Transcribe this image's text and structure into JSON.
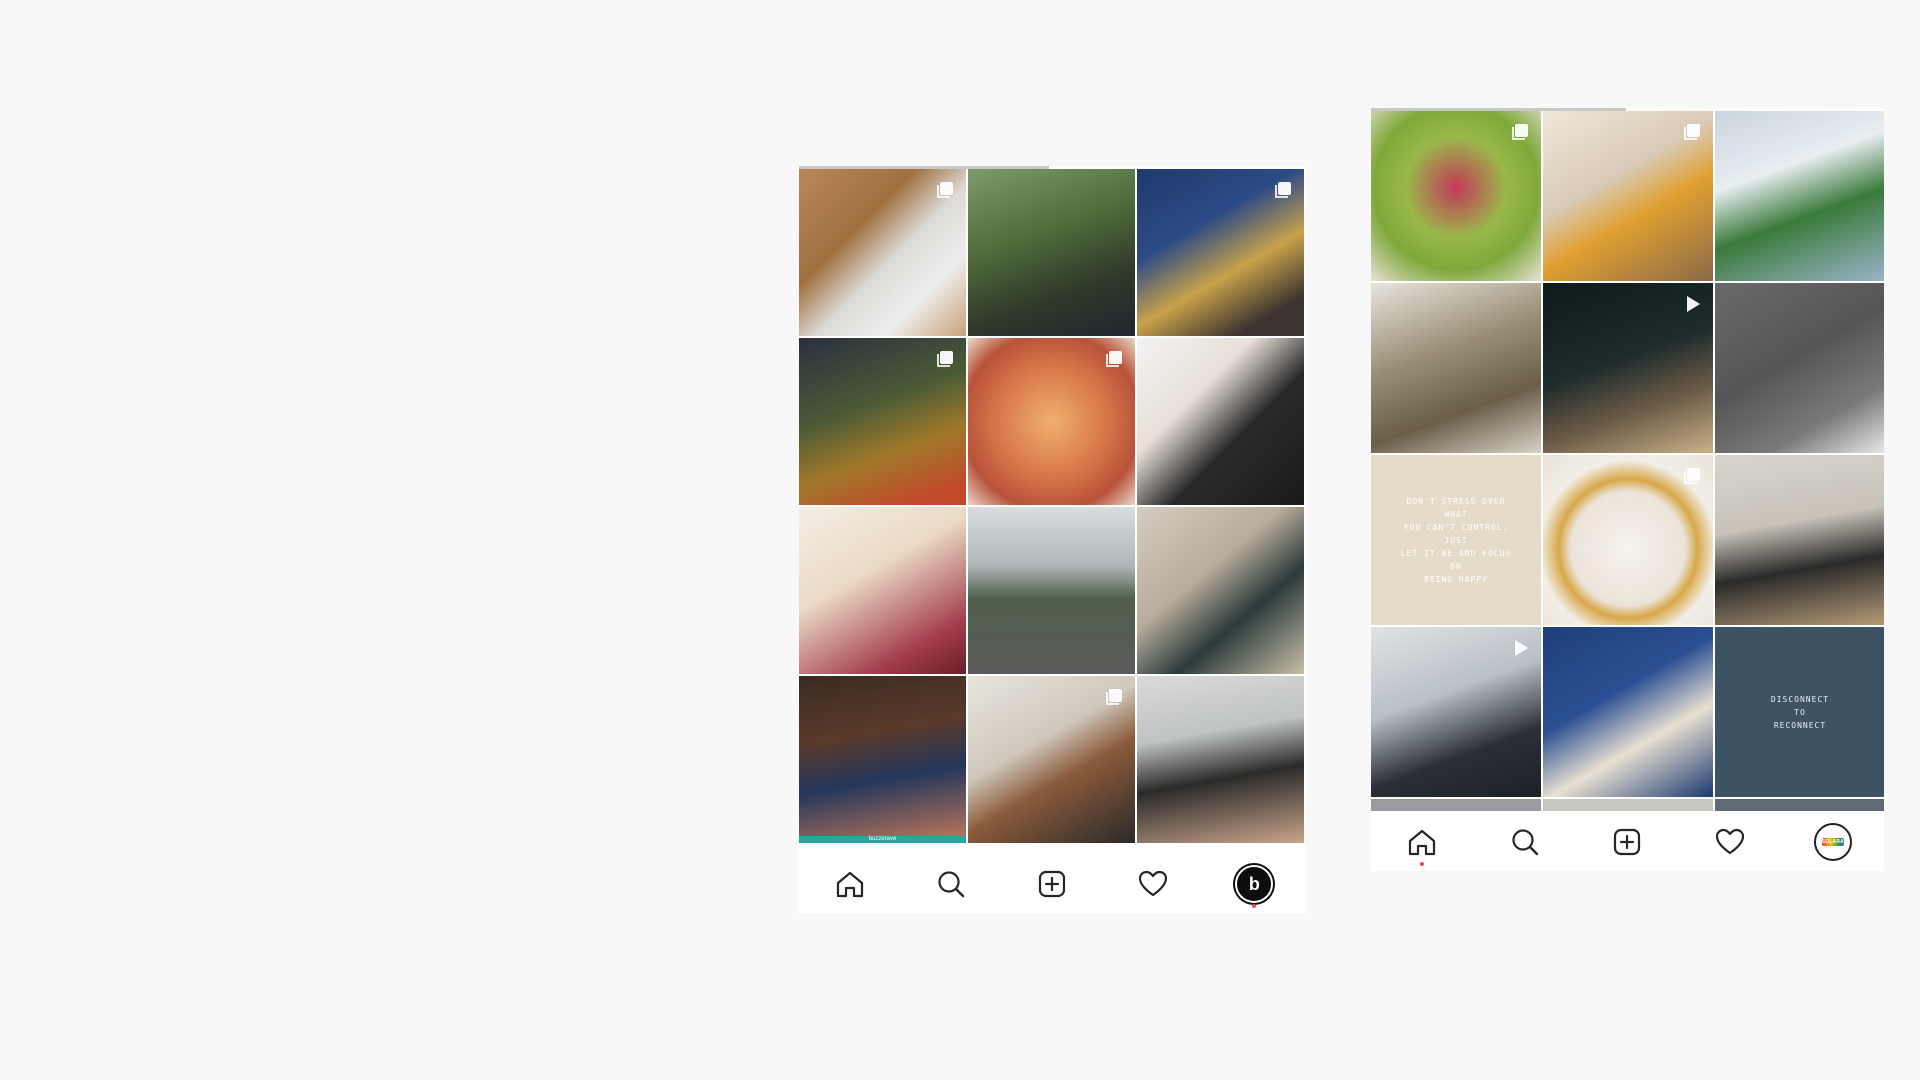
{
  "colors": {
    "page_background": "#f8f8f8",
    "panel_background": "#ffffff",
    "icon_color": "#262626",
    "active_dot": "#ed4956"
  },
  "left_profile": {
    "tiles": [
      {
        "name": "tile-foot-bath",
        "bg": "linear-gradient(135deg,#b9875a 0%,#a0703f 35%,#dcdad6 55%,#eeeeee 75%,#c9a27a 100%)",
        "badge": "multi-icon",
        "text": "",
        "caption": ""
      },
      {
        "name": "tile-garden-filming",
        "bg": "linear-gradient(160deg,#7f9a6a 0%,#4f6b3a 40%,#2f3a2a 70%,#1f2630 100%)",
        "badge": "",
        "text": "",
        "caption": ""
      },
      {
        "name": "tile-restaurant-men",
        "bg": "linear-gradient(150deg,#1f3a6b 0%,#2c4a86 35%,#c8a24a 60%,#3a3330 85%)",
        "badge": "multi-icon",
        "text": "",
        "caption": ""
      },
      {
        "name": "tile-market-woman",
        "bg": "linear-gradient(160deg,#2a3040 0%,#4a5a35 40%,#a0782a 65%,#c24a2a 90%)",
        "badge": "multi-icon",
        "text": "",
        "caption": ""
      },
      {
        "name": "tile-pastry",
        "bg": "radial-gradient(circle at 50% 50%,#f0b070 0%,#d9784a 45%,#b8523a 75%,#e8d8c8 100%)",
        "badge": "multi-icon",
        "text": "",
        "caption": ""
      },
      {
        "name": "tile-two-women",
        "bg": "linear-gradient(135deg,#f2f2f2 0%,#e8e0d8 35%,#2a2a2a 60%,#1a1a1a 100%)",
        "badge": "",
        "text": "",
        "caption": ""
      },
      {
        "name": "tile-blonde-portrait",
        "bg": "linear-gradient(150deg,#f4efe6 0%,#ead9c4 40%,#a23a4a 80%,#6a1f2a 100%)",
        "badge": "",
        "text": "",
        "caption": ""
      },
      {
        "name": "tile-road-woman",
        "bg": "linear-gradient(180deg,#d8dde0 0%,#aeb7b8 35%,#4f5f4a 55%,#5a5a5a 100%)",
        "badge": "",
        "text": "",
        "caption": ""
      },
      {
        "name": "tile-gastromand-books",
        "bg": "linear-gradient(140deg,#d4ccbf 0%,#b8ad9c 40%,#2a3a3a 65%,#c9bfa9 100%)",
        "badge": "",
        "text": "",
        "caption": ""
      },
      {
        "name": "tile-christmas-sweaters",
        "bg": "linear-gradient(170deg,#3a2a22 0%,#5a3a2a 35%,#24365a 60%,#c47a5a 100%)",
        "badge": "",
        "text": "",
        "caption": "buzzerave"
      },
      {
        "name": "tile-kitchen-couple",
        "bg": "linear-gradient(150deg,#e8e4de 0%,#cfc8bc 40%,#8a5a3a 60%,#2a2a2a 100%)",
        "badge": "multi-icon",
        "text": "",
        "caption": ""
      },
      {
        "name": "tile-group-photo",
        "bg": "linear-gradient(170deg,#dadada 0%,#bfc3c2 35%,#2a2a2a 60%,#c9a48a 100%)",
        "badge": "",
        "text": "",
        "caption": ""
      }
    ],
    "caption_color": "#2aa69a",
    "nav": {
      "avatar_letter": "b",
      "active_dot_item": "profile"
    }
  },
  "right_profile": {
    "tiles": [
      {
        "name": "tile-smoothie-bowl",
        "bg": "radial-gradient(circle at 50% 45%,#c23a5a 0%,#9ab84a 40%,#7fa83a 65%,#e8e2d6 100%)",
        "badge": "multi-icon",
        "text": "",
        "text_color": ""
      },
      {
        "name": "tile-lemon-water-hand",
        "bg": "linear-gradient(150deg,#efe6da 0%,#d9cab6 40%,#e0a030 60%,#8a6a4a 100%)",
        "badge": "multi-icon",
        "text": "",
        "text_color": ""
      },
      {
        "name": "tile-cal-mag-bottle",
        "bg": "linear-gradient(160deg,#c9d4dc 0%,#e8eef2 35%,#3a7a3a 60%,#9ab4c8 100%)",
        "badge": "",
        "text": "",
        "text_color": ""
      },
      {
        "name": "tile-woman-supplements",
        "bg": "linear-gradient(160deg,#e8e4de 0%,#9a8f76 40%,#6a5e48 70%,#d8d2c8 100%)",
        "badge": "",
        "text": "",
        "text_color": ""
      },
      {
        "name": "tile-night-pills-video",
        "bg": "linear-gradient(160deg,#0e1a1c 0%,#1d2b2c 45%,#6a5a45 70%,#c9b28a 100%)",
        "badge": "play-icon",
        "text": "",
        "text_color": ""
      },
      {
        "name": "tile-kid-pills-carpet",
        "bg": "linear-gradient(150deg,#6a6a6a 0%,#555555 45%,#7a7a7a 75%,#e8e8e8 100%)",
        "badge": "",
        "text": "",
        "text_color": ""
      },
      {
        "name": "tile-dont-stress-quote",
        "bg": "#e4dcc8",
        "badge": "",
        "text": "DON'T STRESS OVER WHAT\nYOU CAN'T CONTROL. JUST\nLET IT BE AND FOCUS ON\nBEING HAPPY",
        "text_color": "#ffffff"
      },
      {
        "name": "tile-shell-capsules",
        "bg": "radial-gradient(circle at 50% 55%,#f6f2ec 0%,#ece4da 45%,#d8a84a 55%,#f2eee8 70%,#e8e2d8 100%)",
        "badge": "multi-icon",
        "text": "",
        "text_color": ""
      },
      {
        "name": "tile-yoga-woman",
        "bg": "linear-gradient(170deg,#d8d4ce 0%,#c8c2b8 40%,#2a2a2a 65%,#b49a76 100%)",
        "badge": "",
        "text": "",
        "text_color": ""
      },
      {
        "name": "tile-wellness-bottle-video",
        "bg": "linear-gradient(160deg,#dfe3e6 0%,#b9c0c6 40%,#2a2f36 70%,#1c2128 100%)",
        "badge": "play-icon",
        "text": "",
        "text_color": ""
      },
      {
        "name": "tile-blue-table-bottles",
        "bg": "linear-gradient(150deg,#1f3f7a 0%,#2a4f92 40%,#e8e0d2 65%,#1c3870 100%)",
        "badge": "",
        "text": "",
        "text_color": ""
      },
      {
        "name": "tile-disconnect-quote",
        "bg": "#3d5363",
        "badge": "",
        "text": "DISCONNECT\nTO\nRECONNECT",
        "text_color": "#e8eef2"
      },
      {
        "name": "tile-partial-1",
        "bg": "#9a9aa0",
        "badge": "",
        "text": "",
        "text_color": ""
      },
      {
        "name": "tile-partial-2",
        "bg": "#c8c6c0",
        "badge": "",
        "text": "",
        "text_color": ""
      },
      {
        "name": "tile-partial-3",
        "bg": "#5f6a74",
        "badge": "",
        "text": "",
        "text_color": ""
      }
    ],
    "nav": {
      "avatar_brand": "SOLARAY",
      "active_dot_item": "home"
    }
  }
}
